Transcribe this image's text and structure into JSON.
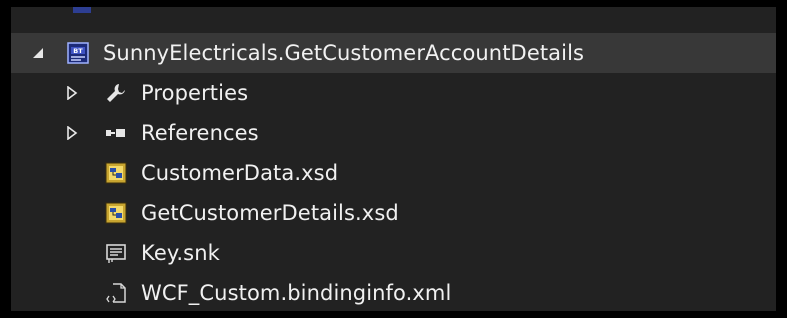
{
  "solution_explorer": {
    "project": {
      "label": "SunnyElectricals.GetCustomerAccountDetails",
      "icon": "biztalk-project-icon",
      "expanded": true
    },
    "items": [
      {
        "label": "Properties",
        "icon": "wrench-icon",
        "expandable": true
      },
      {
        "label": "References",
        "icon": "references-icon",
        "expandable": true
      },
      {
        "label": "CustomerData.xsd",
        "icon": "xsd-schema-icon",
        "expandable": false
      },
      {
        "label": "GetCustomerDetails.xsd",
        "icon": "xsd-schema-icon",
        "expandable": false
      },
      {
        "label": "Key.snk",
        "icon": "key-file-icon",
        "expandable": false
      },
      {
        "label": "WCF_Custom.bindinginfo.xml",
        "icon": "xml-file-icon",
        "expandable": false
      }
    ]
  },
  "colors": {
    "background": "#222222",
    "text": "#f1f1f1",
    "selection": "#383838",
    "project_accent": "#2d3e92"
  }
}
